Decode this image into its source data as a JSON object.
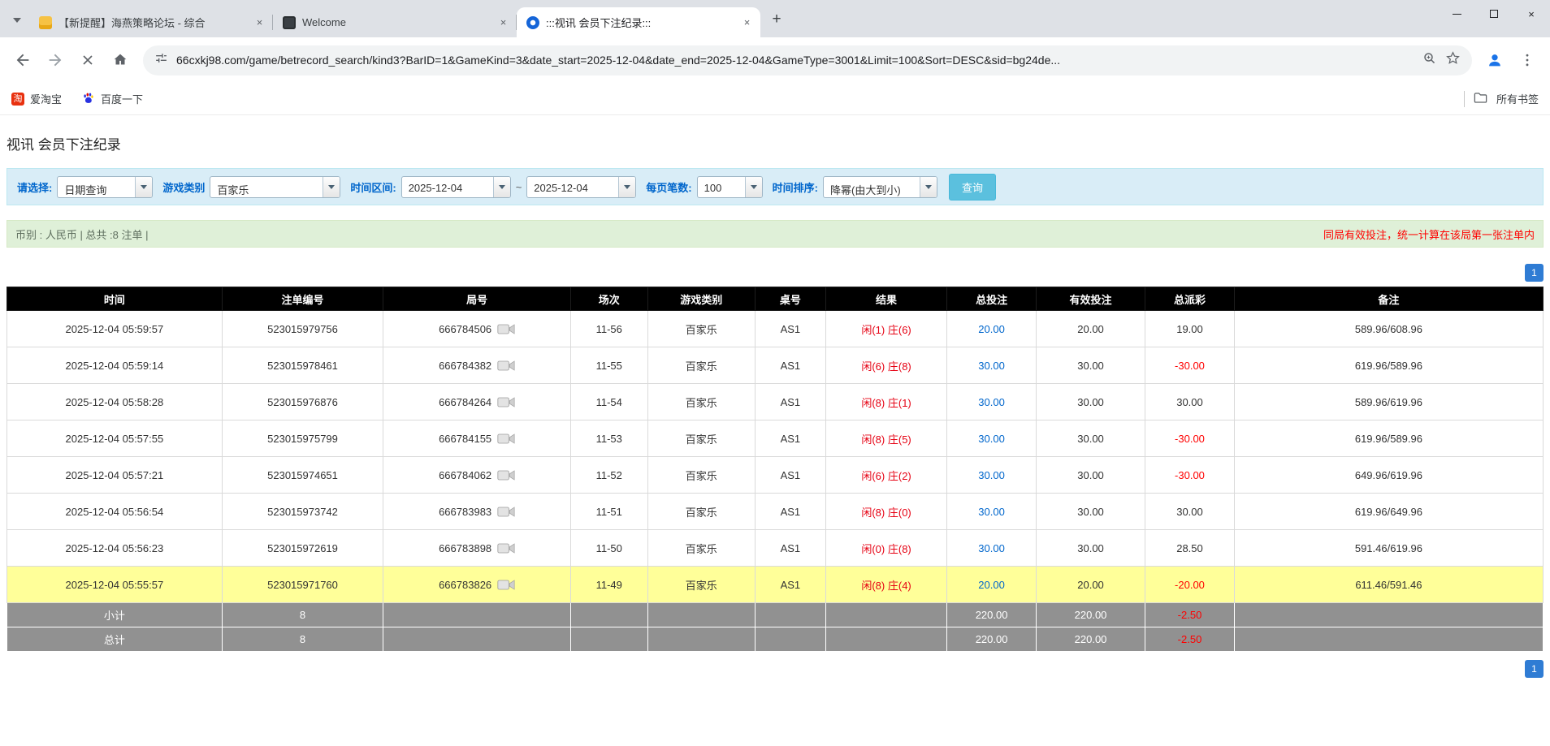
{
  "colors": {
    "filter_bg": "#d9edf7",
    "summary_bg": "#dff0d8",
    "label_blue": "#0066cc",
    "query_btn": "#5bc0de",
    "pager_blue": "#2f7cd4",
    "header_bg": "#000000",
    "footer_bg": "#919191",
    "highlight_yellow": "#ffff99",
    "link_blue": "#0066cc",
    "negative_red": "#ff0000",
    "result_player": "#e60012",
    "result_banker": "#e60012"
  },
  "browser": {
    "tabs": [
      {
        "title": "【新提醒】海燕策略论坛 - 综合"
      },
      {
        "title": "Welcome"
      },
      {
        "title": ":::视讯 会员下注纪录:::"
      }
    ],
    "new_tab": "+",
    "close_glyph": "×",
    "url": "66cxkj98.com/game/betrecord_search/kind3?BarID=1&GameKind=3&date_start=2025-12-04&date_end=2025-12-04&GameType=3001&Limit=100&Sort=DESC&sid=bg24de...",
    "bookmarks": [
      {
        "label": "爱淘宝",
        "icon_char": "淘"
      },
      {
        "label": "百度一下"
      }
    ],
    "all_bookmarks": "所有书签"
  },
  "page": {
    "title": "视讯 会员下注纪录",
    "filter": {
      "select_label": "请选择:",
      "select_value": "日期查询",
      "game_label": "游戏类别",
      "game_value": "百家乐",
      "range_label": "时间区间:",
      "date_start": "2025-12-04",
      "tilde": "~",
      "date_end": "2025-12-04",
      "per_page_label": "每页笔数:",
      "per_page_value": "100",
      "sort_label": "时间排序:",
      "sort_value": "降幂(由大到小)",
      "query_button": "查询"
    },
    "summary_left": "币别 : 人民币 | 总共 :8 注单 |",
    "summary_right": "同局有效投注，统一计算在该局第一张注单内",
    "page_number": "1"
  },
  "table": {
    "headers": [
      "时间",
      "注单编号",
      "局号",
      "场次",
      "游戏类别",
      "桌号",
      "结果",
      "总投注",
      "有效投注",
      "总派彩",
      "备注"
    ],
    "rows": [
      {
        "time": "2025-12-04 05:59:57",
        "bet_id": "523015979756",
        "round": "666784506",
        "session": "11-56",
        "game": "百家乐",
        "table_no": "AS1",
        "player": "闲(1)",
        "banker": "庄(6)",
        "total_bet": "20.00",
        "valid_bet": "20.00",
        "payout": "19.00",
        "note": "589.96/608.96",
        "highlight": false
      },
      {
        "time": "2025-12-04 05:59:14",
        "bet_id": "523015978461",
        "round": "666784382",
        "session": "11-55",
        "game": "百家乐",
        "table_no": "AS1",
        "player": "闲(6)",
        "banker": "庄(8)",
        "total_bet": "30.00",
        "valid_bet": "30.00",
        "payout": "-30.00",
        "note": "619.96/589.96",
        "highlight": false
      },
      {
        "time": "2025-12-04 05:58:28",
        "bet_id": "523015976876",
        "round": "666784264",
        "session": "11-54",
        "game": "百家乐",
        "table_no": "AS1",
        "player": "闲(8)",
        "banker": "庄(1)",
        "total_bet": "30.00",
        "valid_bet": "30.00",
        "payout": "30.00",
        "note": "589.96/619.96",
        "highlight": false
      },
      {
        "time": "2025-12-04 05:57:55",
        "bet_id": "523015975799",
        "round": "666784155",
        "session": "11-53",
        "game": "百家乐",
        "table_no": "AS1",
        "player": "闲(8)",
        "banker": "庄(5)",
        "total_bet": "30.00",
        "valid_bet": "30.00",
        "payout": "-30.00",
        "note": "619.96/589.96",
        "highlight": false
      },
      {
        "time": "2025-12-04 05:57:21",
        "bet_id": "523015974651",
        "round": "666784062",
        "session": "11-52",
        "game": "百家乐",
        "table_no": "AS1",
        "player": "闲(6)",
        "banker": "庄(2)",
        "total_bet": "30.00",
        "valid_bet": "30.00",
        "payout": "-30.00",
        "note": "649.96/619.96",
        "highlight": false
      },
      {
        "time": "2025-12-04 05:56:54",
        "bet_id": "523015973742",
        "round": "666783983",
        "session": "11-51",
        "game": "百家乐",
        "table_no": "AS1",
        "player": "闲(8)",
        "banker": "庄(0)",
        "total_bet": "30.00",
        "valid_bet": "30.00",
        "payout": "30.00",
        "note": "619.96/649.96",
        "highlight": false
      },
      {
        "time": "2025-12-04 05:56:23",
        "bet_id": "523015972619",
        "round": "666783898",
        "session": "11-50",
        "game": "百家乐",
        "table_no": "AS1",
        "player": "闲(0)",
        "banker": "庄(8)",
        "total_bet": "30.00",
        "valid_bet": "30.00",
        "payout": "28.50",
        "note": "591.46/619.96",
        "highlight": false
      },
      {
        "time": "2025-12-04 05:55:57",
        "bet_id": "523015971760",
        "round": "666783826",
        "session": "11-49",
        "game": "百家乐",
        "table_no": "AS1",
        "player": "闲(8)",
        "banker": "庄(4)",
        "total_bet": "20.00",
        "valid_bet": "20.00",
        "payout": "-20.00",
        "note": "611.46/591.46",
        "highlight": true
      }
    ],
    "footer": [
      {
        "label": "小计",
        "count": "8",
        "total_bet": "220.00",
        "valid_bet": "220.00",
        "payout": "-2.50"
      },
      {
        "label": "总计",
        "count": "8",
        "total_bet": "220.00",
        "valid_bet": "220.00",
        "payout": "-2.50"
      }
    ]
  }
}
